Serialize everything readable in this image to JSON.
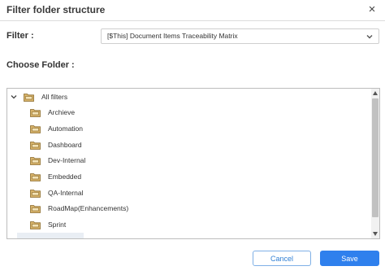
{
  "dialog": {
    "title": "Filter folder structure",
    "close_glyph": "×"
  },
  "filter": {
    "label": "Filter :",
    "selected": "[$This] Document Items Traceability Matrix"
  },
  "choose_folder": {
    "label": "Choose Folder :"
  },
  "tree": {
    "root": {
      "label": "All filters",
      "expanded": true
    },
    "children": [
      {
        "label": "Archieve"
      },
      {
        "label": "Automation"
      },
      {
        "label": "Dashboard"
      },
      {
        "label": "Dev-Internal"
      },
      {
        "label": "Embedded"
      },
      {
        "label": "QA-Internal"
      },
      {
        "label": "RoadMap(Enhancements)"
      },
      {
        "label": "Sprint"
      }
    ]
  },
  "buttons": {
    "cancel": "Cancel",
    "save": "Save"
  },
  "colors": {
    "primary": "#2f80ed",
    "folder": "#c9a25a"
  }
}
